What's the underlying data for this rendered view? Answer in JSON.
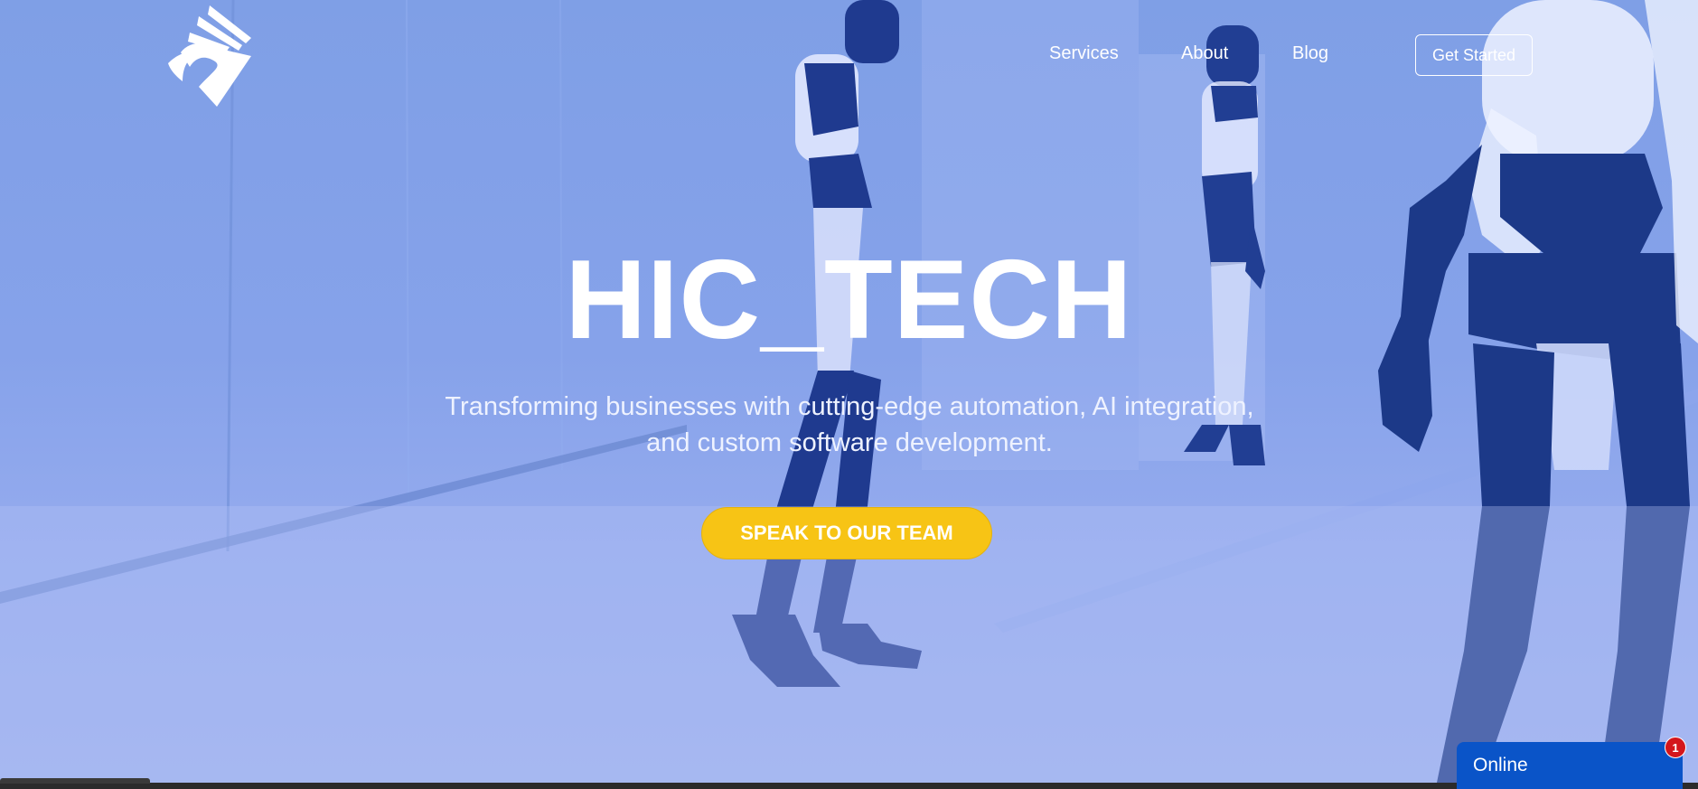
{
  "brand": {
    "logo_icon": "hawk-logo-icon"
  },
  "nav": {
    "items": [
      {
        "label": "Services"
      },
      {
        "label": "About"
      },
      {
        "label": "Blog"
      }
    ],
    "cta_label": "Get Started"
  },
  "hero": {
    "title": "HIC_TECH",
    "subtitle_line1": "Transforming businesses with cutting-edge automation, AI integration,",
    "subtitle_line2": "and custom software development.",
    "cta_label": "SPEAK TO OUR TEAM",
    "background": "humanoid robots walking in white corridor, blue tint"
  },
  "chat_widget": {
    "label": "Online",
    "badge_count": "1"
  },
  "colors": {
    "accent_yellow": "#f7c415",
    "chat_blue": "#0a54c8",
    "badge_red": "#d4161c",
    "hero_tint": "#86a2ea"
  }
}
